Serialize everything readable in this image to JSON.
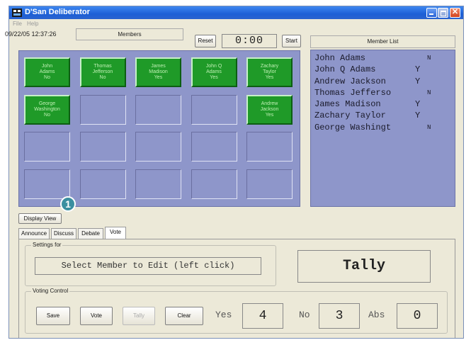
{
  "window": {
    "title": "D'San Deliberator"
  },
  "menu": {
    "file": "File",
    "help": "Help"
  },
  "header": {
    "datetime": "09/22/05 12:37:26",
    "members_label": "Members",
    "reset_label": "Reset",
    "timer": "0:00",
    "start_label": "Start",
    "member_list_label": "Member List"
  },
  "grid": {
    "members": [
      {
        "first": "John",
        "last": "Adams",
        "vote": "No"
      },
      {
        "first": "Thomas",
        "last": "Jefferson",
        "vote": "No"
      },
      {
        "first": "James",
        "last": "Madison",
        "vote": "Yes"
      },
      {
        "first": "John Q",
        "last": "Adams",
        "vote": "Yes"
      },
      {
        "first": "Zachary",
        "last": "Taylor",
        "vote": "Yes"
      },
      {
        "first": "George",
        "last": "Washington",
        "vote": "No"
      },
      {
        "first": "Andrew",
        "last": "Jackson",
        "vote": "Yes"
      }
    ],
    "colors": {
      "member_fill": "#1f9a28",
      "empty_fill": "#8e96ca"
    }
  },
  "member_list": [
    {
      "name": "John Adams",
      "vote": "N"
    },
    {
      "name": "John Q Adams",
      "vote": "Y"
    },
    {
      "name": "Andrew Jackson",
      "vote": "Y"
    },
    {
      "name": "Thomas Jefferso",
      "vote": "N"
    },
    {
      "name": "James Madison",
      "vote": "Y"
    },
    {
      "name": "Zachary Taylor",
      "vote": "Y"
    },
    {
      "name": "George Washingt",
      "vote": "N"
    }
  ],
  "display_view_label": "Display View",
  "callout_number": "1",
  "tabs": [
    {
      "label": "Announce"
    },
    {
      "label": "Discuss"
    },
    {
      "label": "Debate"
    },
    {
      "label": "Vote",
      "active": true
    }
  ],
  "settings": {
    "group_label": "Settings for",
    "select_text": "Select Member to Edit (left click)",
    "tally_label": "Tally"
  },
  "voting": {
    "group_label": "Voting Control",
    "save_label": "Save",
    "vote_label": "Vote",
    "tally_label": "Tally",
    "clear_label": "Clear",
    "yes_label": "Yes",
    "yes_count": "4",
    "no_label": "No",
    "no_count": "3",
    "abs_label": "Abs",
    "abs_count": "0"
  }
}
